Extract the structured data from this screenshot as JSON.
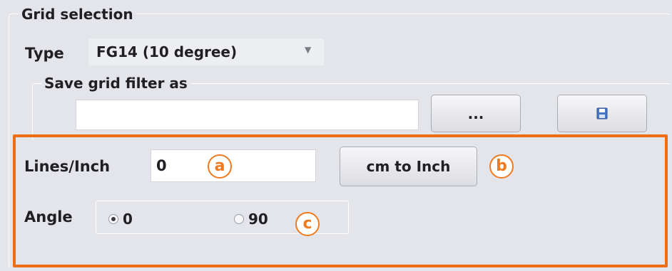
{
  "grid_selection": {
    "title": "Grid selection",
    "type_label": "Type",
    "type_value": "FG14 (10 degree)",
    "dropdown_arrow": "▼",
    "save_filter": {
      "title": "Save grid filter as",
      "value": "",
      "browse_label": "...",
      "save_icon": "floppy-disk-icon"
    }
  },
  "settings": {
    "lines_per_inch_label": "Lines/Inch",
    "lines_per_inch_value": "0",
    "convert_button_label": "cm to Inch",
    "angle_label": "Angle",
    "angle_options": [
      {
        "label": "0",
        "selected": true
      },
      {
        "label": "90",
        "selected": false
      }
    ]
  },
  "callouts": {
    "a": "a",
    "b": "b",
    "c": "c",
    "color": "#f07a1f"
  },
  "highlight_color": "#ee6d12"
}
